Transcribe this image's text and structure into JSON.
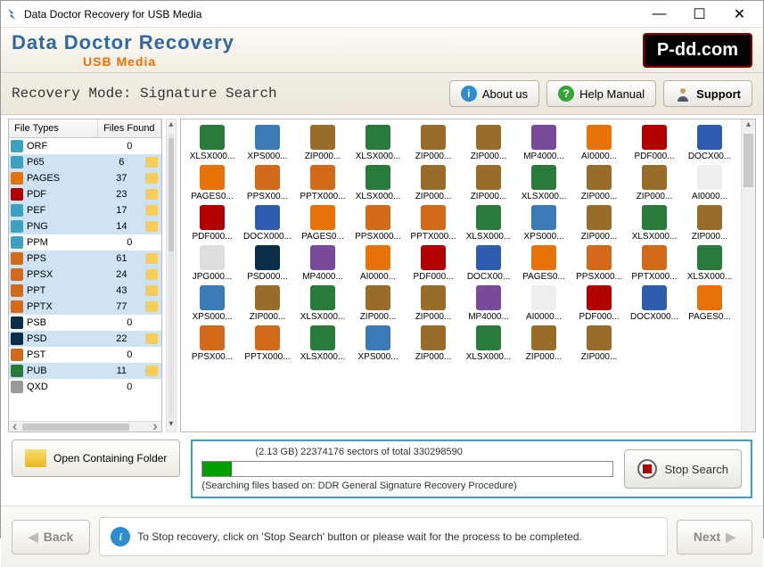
{
  "window": {
    "title": "Data Doctor Recovery for USB Media"
  },
  "header": {
    "title": "Data Doctor Recovery",
    "subtitle": "USB Media",
    "brand": "P-dd.com"
  },
  "toolbar": {
    "recovery_mode": "Recovery Mode: Signature Search",
    "about": "About us",
    "help": "Help Manual",
    "support": "Support"
  },
  "file_types": {
    "col_type": "File Types",
    "col_found": "Files Found",
    "rows": [
      {
        "name": "ORF",
        "count": 0,
        "sel": false,
        "ic": "#3da2c2"
      },
      {
        "name": "P65",
        "count": 6,
        "sel": true,
        "ic": "#3da2c2"
      },
      {
        "name": "PAGES",
        "count": 37,
        "sel": true,
        "ic": "#e8720a"
      },
      {
        "name": "PDF",
        "count": 23,
        "sel": true,
        "ic": "#b00000"
      },
      {
        "name": "PEF",
        "count": 17,
        "sel": true,
        "ic": "#3da2c2"
      },
      {
        "name": "PNG",
        "count": 14,
        "sel": true,
        "ic": "#3da2c2"
      },
      {
        "name": "PPM",
        "count": 0,
        "sel": false,
        "ic": "#3da2c2"
      },
      {
        "name": "PPS",
        "count": 61,
        "sel": true,
        "ic": "#d36a1a"
      },
      {
        "name": "PPSX",
        "count": 24,
        "sel": true,
        "ic": "#d36a1a"
      },
      {
        "name": "PPT",
        "count": 43,
        "sel": true,
        "ic": "#d36a1a"
      },
      {
        "name": "PPTX",
        "count": 77,
        "sel": true,
        "ic": "#d36a1a"
      },
      {
        "name": "PSB",
        "count": 0,
        "sel": false,
        "ic": "#0a2d4a"
      },
      {
        "name": "PSD",
        "count": 22,
        "sel": true,
        "ic": "#0a2d4a"
      },
      {
        "name": "PST",
        "count": 0,
        "sel": false,
        "ic": "#d36a1a"
      },
      {
        "name": "PUB",
        "count": 11,
        "sel": true,
        "ic": "#2a7a3a"
      },
      {
        "name": "QXD",
        "count": 0,
        "sel": false,
        "ic": "#999"
      }
    ]
  },
  "files_grid": {
    "rows": [
      [
        {
          "n": "XLSX000...",
          "c": "#2a7a3a"
        },
        {
          "n": "XPS000...",
          "c": "#3a7ab5"
        },
        {
          "n": "ZIP000...",
          "c": "#9a6c2a"
        },
        {
          "n": "XLSX000...",
          "c": "#2a7a3a"
        },
        {
          "n": "ZIP000...",
          "c": "#9a6c2a"
        },
        {
          "n": "ZIP000...",
          "c": "#9a6c2a"
        },
        {
          "n": "MP4000...",
          "c": "#7a4a9a"
        },
        {
          "n": "AI0000...",
          "c": "#e8720a"
        },
        {
          "n": "PDF000...",
          "c": "#b00000"
        },
        {
          "n": "DOCX00...",
          "c": "#2e5db0"
        }
      ],
      [
        {
          "n": "PAGES0...",
          "c": "#e8720a"
        },
        {
          "n": "PPSX00...",
          "c": "#d36a1a"
        },
        {
          "n": "PPTX000...",
          "c": "#d36a1a"
        },
        {
          "n": "XLSX000...",
          "c": "#2a7a3a"
        },
        {
          "n": "ZIP000...",
          "c": "#9a6c2a"
        },
        {
          "n": "ZIP000...",
          "c": "#9a6c2a"
        },
        {
          "n": "XLSX000...",
          "c": "#2a7a3a"
        },
        {
          "n": "ZIP000...",
          "c": "#9a6c2a"
        },
        {
          "n": "ZIP000...",
          "c": "#9a6c2a"
        },
        {
          "n": "AI0000...",
          "c": "#eee"
        }
      ],
      [
        {
          "n": "PDF000...",
          "c": "#b00000"
        },
        {
          "n": "DOCX000...",
          "c": "#2e5db0"
        },
        {
          "n": "PAGES0...",
          "c": "#e8720a"
        },
        {
          "n": "PPSX000...",
          "c": "#d36a1a"
        },
        {
          "n": "PPTX000...",
          "c": "#d36a1a"
        },
        {
          "n": "XLSX000...",
          "c": "#2a7a3a"
        },
        {
          "n": "XPS000...",
          "c": "#3a7ab5"
        },
        {
          "n": "ZIP000...",
          "c": "#9a6c2a"
        },
        {
          "n": "XLSX000...",
          "c": "#2a7a3a"
        },
        {
          "n": "ZIP000...",
          "c": "#9a6c2a"
        }
      ],
      [
        {
          "n": "JPG000...",
          "c": "#ddd"
        },
        {
          "n": "PSD000...",
          "c": "#0a2d4a"
        },
        {
          "n": "MP4000...",
          "c": "#7a4a9a"
        },
        {
          "n": "AI0000...",
          "c": "#e8720a"
        },
        {
          "n": "PDF000...",
          "c": "#b00000"
        },
        {
          "n": "DOCX00...",
          "c": "#2e5db0"
        },
        {
          "n": "PAGES0...",
          "c": "#e8720a"
        },
        {
          "n": "PPSX000...",
          "c": "#d36a1a"
        },
        {
          "n": "PPTX000...",
          "c": "#d36a1a"
        },
        {
          "n": "XLSX000...",
          "c": "#2a7a3a"
        }
      ],
      [
        {
          "n": "XPS000...",
          "c": "#3a7ab5"
        },
        {
          "n": "ZIP000...",
          "c": "#9a6c2a"
        },
        {
          "n": "XLSX000...",
          "c": "#2a7a3a"
        },
        {
          "n": "ZIP000...",
          "c": "#9a6c2a"
        },
        {
          "n": "ZIP000...",
          "c": "#9a6c2a"
        },
        {
          "n": "MP4000...",
          "c": "#7a4a9a"
        },
        {
          "n": "AI0000...",
          "c": "#eee"
        },
        {
          "n": "PDF000...",
          "c": "#b00000"
        },
        {
          "n": "DOCX000...",
          "c": "#2e5db0"
        },
        {
          "n": "PAGES0...",
          "c": "#e8720a"
        }
      ],
      [
        {
          "n": "PPSX00...",
          "c": "#d36a1a"
        },
        {
          "n": "PPTX000...",
          "c": "#d36a1a"
        },
        {
          "n": "XLSX000...",
          "c": "#2a7a3a"
        },
        {
          "n": "XPS000...",
          "c": "#3a7ab5"
        },
        {
          "n": "ZIP000...",
          "c": "#9a6c2a"
        },
        {
          "n": "XLSX000...",
          "c": "#2a7a3a"
        },
        {
          "n": "ZIP000...",
          "c": "#9a6c2a"
        },
        {
          "n": "ZIP000...",
          "c": "#9a6c2a"
        }
      ]
    ]
  },
  "open_folder": "Open Containing Folder",
  "progress": {
    "info": "(2.13 GB) 22374176   sectors  of  total 330298590",
    "searching": "(Searching files based on:  DDR General Signature Recovery Procedure)",
    "stop": "Stop Search"
  },
  "footer": {
    "back": "Back",
    "next": "Next",
    "hint": "To Stop recovery, click on 'Stop Search' button or please wait for the process to be completed."
  }
}
